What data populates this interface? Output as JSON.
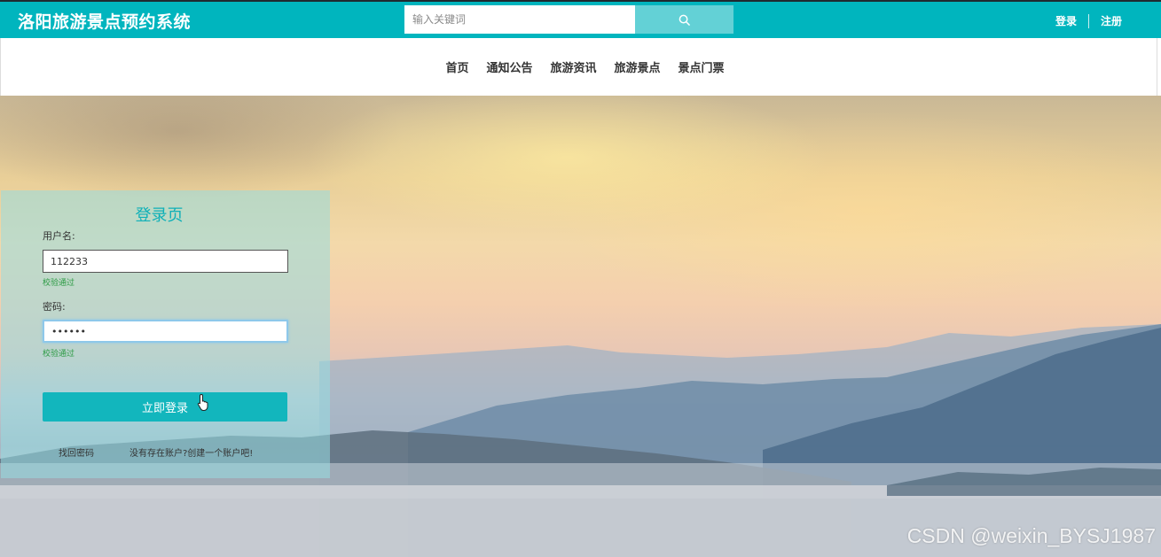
{
  "header": {
    "site_title": "洛阳旅游景点预约系统",
    "search_placeholder": "输入关键词",
    "search_icon": "search-icon",
    "login": "登录",
    "register": "注册"
  },
  "nav": {
    "items": [
      "首页",
      "通知公告",
      "旅游资讯",
      "旅游景点",
      "景点门票"
    ]
  },
  "login_form": {
    "title": "登录页",
    "username_label": "用户名:",
    "username_value": "112233",
    "username_hint": "校验通过",
    "password_label": "密码:",
    "password_value": "••••••",
    "password_hint": "校验通过",
    "submit_label": "立即登录",
    "forgot_link": "找回密码",
    "signup_link": "没有存在账户?创建一个账户吧!"
  },
  "watermark": "CSDN @weixin_BYSJ1987",
  "colors": {
    "brand": "#00b5be",
    "button": "#12b6bd",
    "hint": "#2d9b45"
  }
}
